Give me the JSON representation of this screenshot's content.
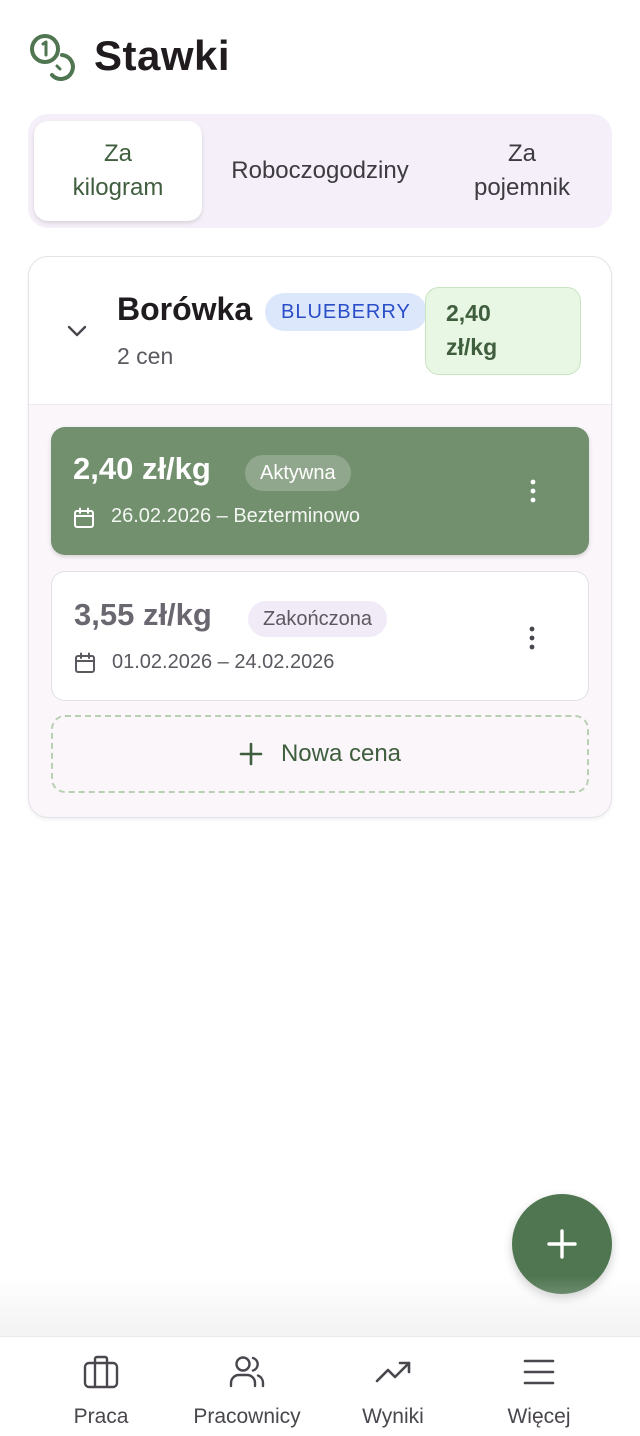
{
  "header": {
    "title": "Stawki",
    "icon": "coins-icon"
  },
  "tabs": [
    {
      "line1": "Za",
      "line2": "kilogram",
      "active": true
    },
    {
      "line1": "Roboczogodziny",
      "line2": "",
      "active": false
    },
    {
      "line1": "Za",
      "line2": "pojemnik",
      "active": false
    }
  ],
  "product": {
    "name": "Borówka",
    "badge": "BLUEBERRY",
    "count": "2 cen",
    "rate_value": "2,40",
    "rate_unit": "zł/kg"
  },
  "prices": [
    {
      "amount": "2,40 zł/kg",
      "status": "Aktywna",
      "dates": "26.02.2026 – Bezterminowo"
    },
    {
      "amount": "3,55 zł/kg",
      "status": "Zakończona",
      "dates": "01.02.2026 – 24.02.2026"
    }
  ],
  "new_price_label": "Nowa cena",
  "nav": [
    {
      "label": "Praca",
      "icon": "briefcase-icon"
    },
    {
      "label": "Pracownicy",
      "icon": "users-icon"
    },
    {
      "label": "Wyniki",
      "icon": "trending-up-icon"
    },
    {
      "label": "Więcej",
      "icon": "menu-icon"
    }
  ],
  "colors": {
    "primary": "#4f7650",
    "active_card": "#728f6e",
    "badge_blue": "#2a4ec8",
    "rate_bg": "#e8f7e3"
  }
}
